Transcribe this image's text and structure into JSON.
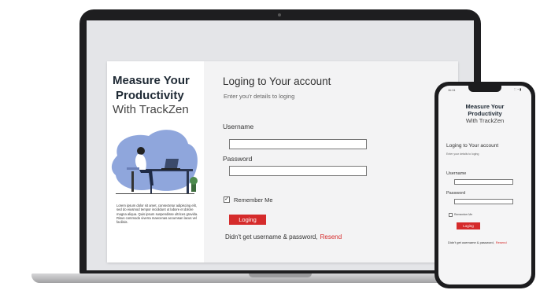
{
  "web": {
    "brand": {
      "line1": "Measure Your",
      "line2": "Productivity",
      "line3": "With TrackZen"
    },
    "description": "Lorem ipsum dolor sit amet, consectetur adipiscing elit, sed do eiusmod tempor incididunt ut labore et dolore magna aliqua. Quis ipsum suspendisse ultrices gravida. Risus commodo viverra maecenas accumsan lacus vel facilisis.",
    "login": {
      "title": "Loging to Your account",
      "subtitle": "Enter you'r details to loging",
      "username_label": "Username",
      "password_label": "Password",
      "remember_label": "Remember Me",
      "remember_checked": true,
      "button_label": "Loging",
      "forgot_text": "Didn't get username & password,",
      "resend_label": "Resend"
    }
  },
  "mobile": {
    "status_time": "11:11",
    "status_icons": "∷ ◔ ▮",
    "brand": {
      "line1": "Measure Your",
      "line2": "Productivity",
      "line3": "With TrackZen"
    },
    "login": {
      "title": "Loging to Your account",
      "subtitle": "Enter your details to loging",
      "username_label": "Username",
      "password_label": "Password",
      "remember_label": "Remember Me",
      "button_label": "Loging",
      "forgot_text": "Didn't get username & password,",
      "resend_label": "Resend"
    }
  },
  "colors": {
    "accent": "#d52b2b",
    "illustration_blob": "#8fa6dc",
    "device_frame": "#1e1e20"
  }
}
